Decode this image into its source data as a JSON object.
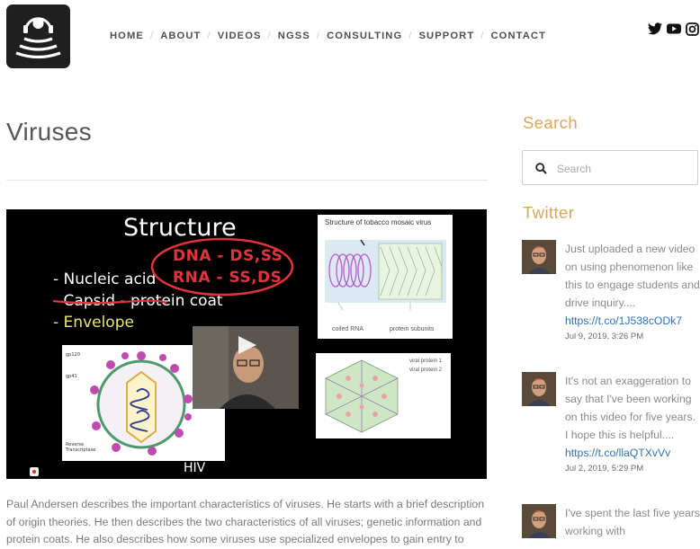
{
  "nav": {
    "items": [
      "HOME",
      "ABOUT",
      "VIDEOS",
      "NGSS",
      "CONSULTING",
      "SUPPORT",
      "CONTACT"
    ]
  },
  "social": [
    "twitter-icon",
    "youtube-icon",
    "instagram-icon"
  ],
  "page": {
    "title": "Viruses"
  },
  "video": {
    "heading": "Structure",
    "bullets": [
      "Nucleic acid",
      "Capsid - protein coat",
      "Envelope"
    ],
    "annotation_line1": "DNA - DS,SS",
    "annotation_line2": "RNA - SS,DS",
    "tmv_caption": "Structure of tobacco mosaic virus",
    "tmv_label_left": "coiled RNA",
    "tmv_label_right": "protein subunits",
    "hex_label_1": "viral protein 1",
    "hex_label_2": "viral protein 2",
    "hiv_label": "HIV"
  },
  "description": "Paul Andersen describes the important characteristics of viruses. He starts with a brief description of origin theories. He then describes the two characteristics of all viruses; genetic information and protein coats. He also describes how some viruses use specialized envelopes to gain entry to",
  "sidebar": {
    "search_heading": "Search",
    "search_placeholder": "Search",
    "twitter_heading": "Twitter",
    "tweets": [
      {
        "text": "Just uploaded a new video on using phenomenon like this to engage students and drive inquiry....",
        "link": "https://t.co/1J538cODk7",
        "date": "Jul 9, 2019, 3:26 PM"
      },
      {
        "text": "It's not an exaggeration to say that I've been working on this video for five years. I hope this is helpful....",
        "link": "https://t.co/llaQTXvVv",
        "date": "Jul 2, 2019, 5:29 PM"
      },
      {
        "text": "I've spent the last five years working with",
        "link": "",
        "date": ""
      }
    ]
  },
  "colors": {
    "accent": "#d9a85a",
    "link": "#2d72b8",
    "logo_bg": "#1f1f1f"
  }
}
